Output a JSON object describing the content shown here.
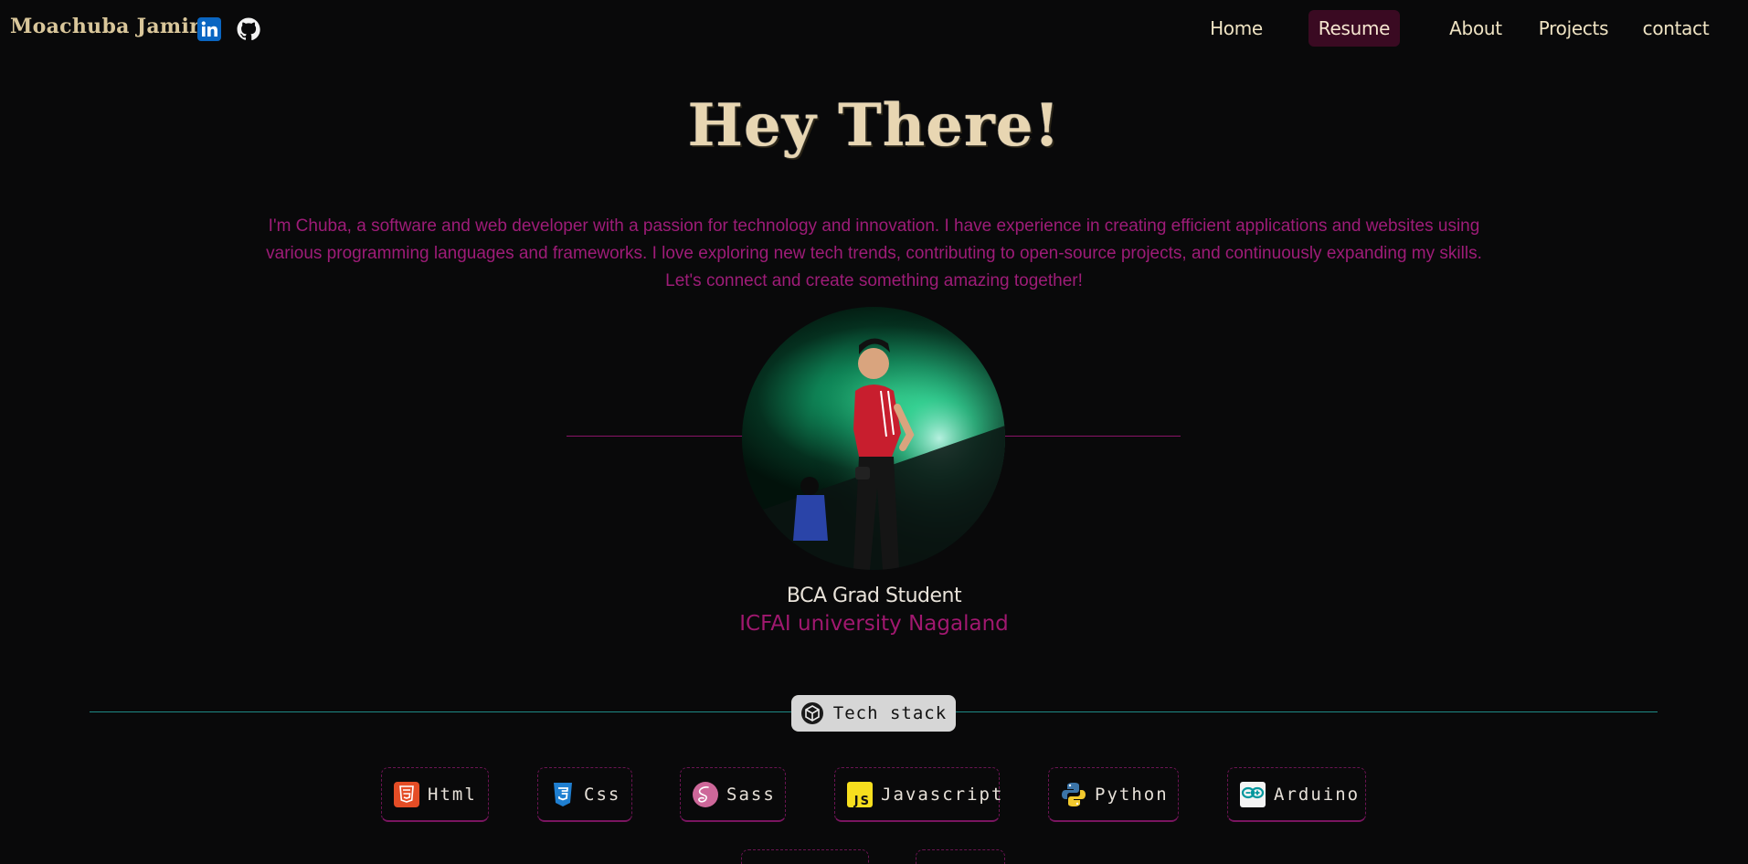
{
  "header": {
    "brand": "Moachuba Jamir",
    "social": [
      {
        "icon": "linkedin-icon"
      },
      {
        "icon": "github-icon"
      }
    ],
    "nav": [
      {
        "label": "Home",
        "active": false
      },
      {
        "label": "Resume",
        "active": true
      },
      {
        "label": "About",
        "active": false
      },
      {
        "label": "Projects",
        "active": false
      },
      {
        "label": "contact",
        "active": false
      }
    ]
  },
  "hero": {
    "title": "Hey There!",
    "intro_lines": [
      "I'm Chuba, a software and web developer with a passion for technology and innovation. I have experience in creating efficient applications and websites using",
      "various programming languages and frameworks. I love exploring new tech trends, contributing to open-source projects, and continuously expanding my skills.",
      "Let's connect and create something amazing together!"
    ],
    "degree": "BCA Grad Student",
    "university": "ICFAI university Nagaland"
  },
  "tech_stack": {
    "title": "Tech stack",
    "items": [
      {
        "label": "Html",
        "icon": "html5-icon"
      },
      {
        "label": "Css",
        "icon": "css3-icon"
      },
      {
        "label": "Sass",
        "icon": "sass-icon"
      },
      {
        "label": "Javascript",
        "icon": "javascript-icon"
      },
      {
        "label": "Python",
        "icon": "python-icon"
      },
      {
        "label": "Arduino",
        "icon": "arduino-icon"
      }
    ]
  },
  "colors": {
    "background": "#09090a",
    "accent_magenta": "#a0186f",
    "nav_active_bg": "#3a0a22",
    "teal_line": "#1e8a86"
  }
}
